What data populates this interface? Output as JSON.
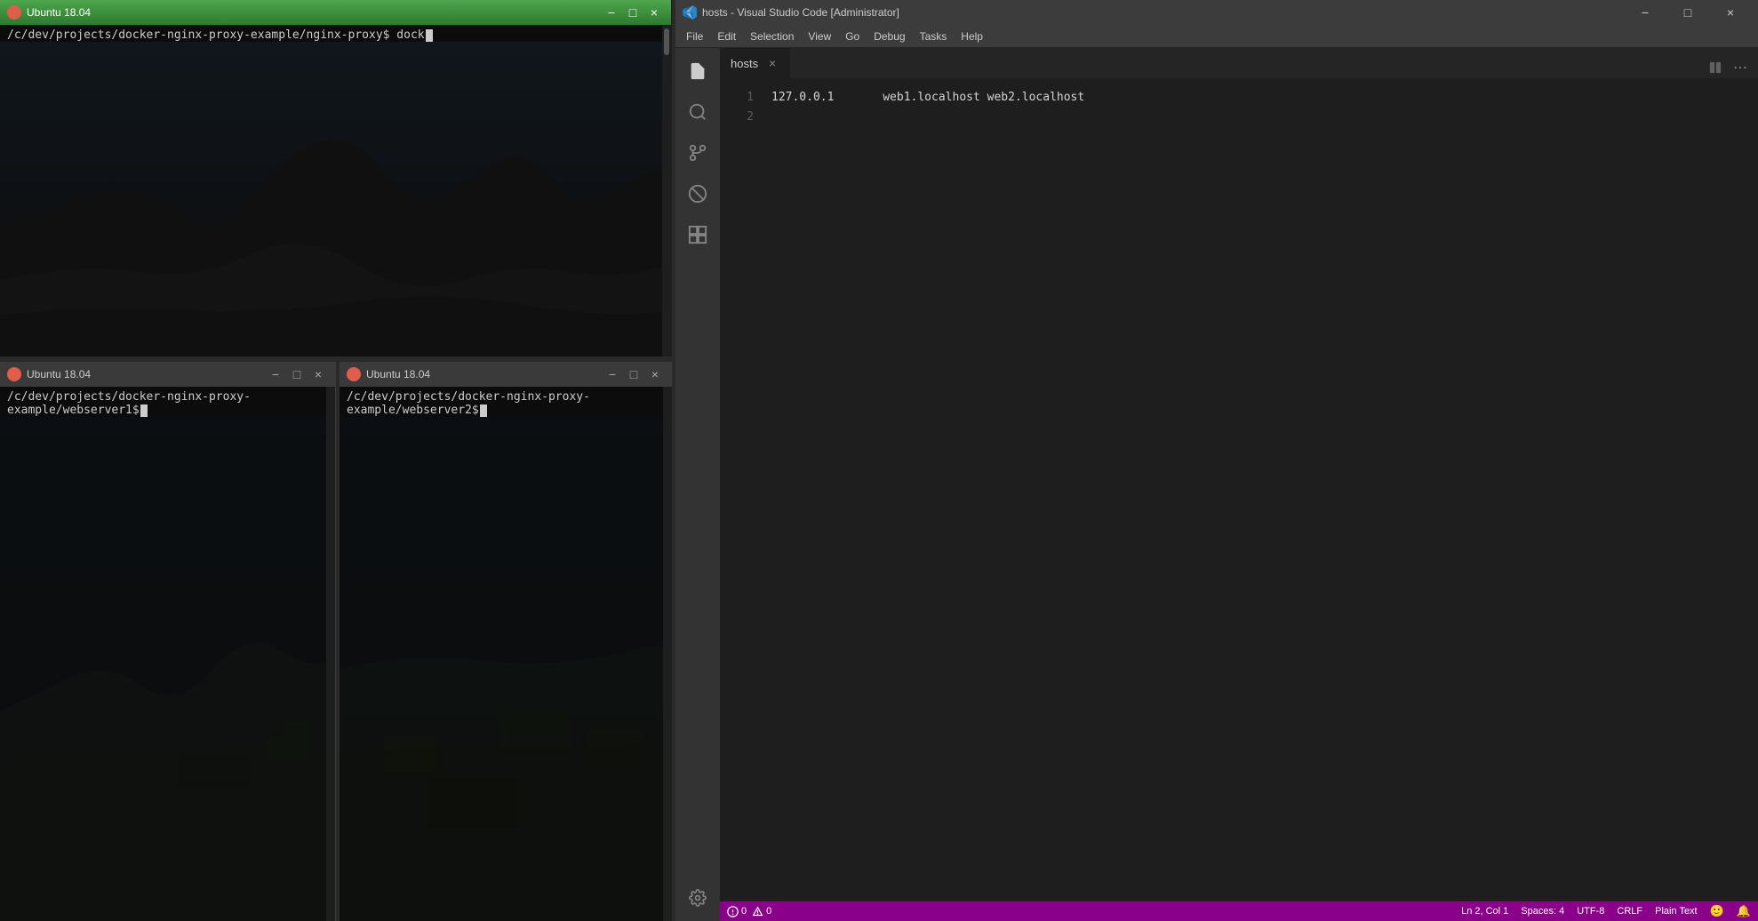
{
  "terminals": {
    "nginx": {
      "title": "Ubuntu 18.04",
      "path": "/c/dev/projects/docker-nginx-proxy-example/nginx-proxy$ dock",
      "icon_color": "#e05c4b"
    },
    "web1": {
      "title": "Ubuntu 18.04",
      "path": "/c/dev/projects/docker-nginx-proxy-example/webserver1$",
      "icon_color": "#e05c4b"
    },
    "web2": {
      "title": "Ubuntu 18.04",
      "path": "/c/dev/projects/docker-nginx-proxy-example/webserver2$",
      "icon_color": "#e05c4b"
    }
  },
  "vscode": {
    "window_title": "hosts - Visual Studio Code [Administrator]",
    "menu": {
      "items": [
        "File",
        "Edit",
        "Selection",
        "View",
        "Go",
        "Debug",
        "Tasks",
        "Help"
      ]
    },
    "tab": {
      "label": "hosts",
      "close_icon": "×"
    },
    "editor": {
      "lines": [
        {
          "number": "1",
          "content": "127.0.0.1       web1.localhost web2.localhost"
        },
        {
          "number": "2",
          "content": ""
        }
      ]
    },
    "status_bar": {
      "errors": "0",
      "warnings": "0",
      "line_col": "Ln 2, Col 1",
      "spaces": "Spaces: 4",
      "encoding": "UTF-8",
      "line_ending": "CRLF",
      "language": "Plain Text",
      "smiley": "🙂",
      "bell": "🔔"
    }
  },
  "window_controls": {
    "minimize": "−",
    "maximize": "□",
    "close": "×"
  }
}
